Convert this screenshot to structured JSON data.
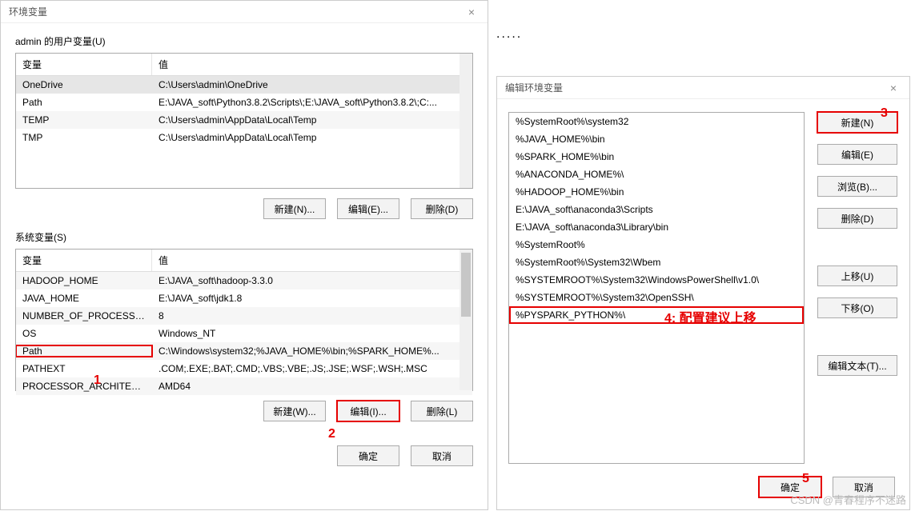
{
  "ellipsis": ".....",
  "dlg1": {
    "title": "环境变量",
    "user_section": "admin 的用户变量(U)",
    "sys_section": "系统变量(S)",
    "cols": {
      "var": "变量",
      "val": "值"
    },
    "user_vars": [
      {
        "name": "OneDrive",
        "value": "C:\\Users\\admin\\OneDrive"
      },
      {
        "name": "Path",
        "value": "E:\\JAVA_soft\\Python3.8.2\\Scripts\\;E:\\JAVA_soft\\Python3.8.2\\;C:..."
      },
      {
        "name": "TEMP",
        "value": "C:\\Users\\admin\\AppData\\Local\\Temp"
      },
      {
        "name": "TMP",
        "value": "C:\\Users\\admin\\AppData\\Local\\Temp"
      }
    ],
    "sys_vars": [
      {
        "name": "HADOOP_HOME",
        "value": "E:\\JAVA_soft\\hadoop-3.3.0"
      },
      {
        "name": "JAVA_HOME",
        "value": "E:\\JAVA_soft\\jdk1.8"
      },
      {
        "name": "NUMBER_OF_PROCESSORS",
        "value": "8"
      },
      {
        "name": "OS",
        "value": "Windows_NT"
      },
      {
        "name": "Path",
        "value": "C:\\Windows\\system32;%JAVA_HOME%\\bin;%SPARK_HOME%..."
      },
      {
        "name": "PATHEXT",
        "value": ".COM;.EXE;.BAT;.CMD;.VBS;.VBE;.JS;.JSE;.WSF;.WSH;.MSC"
      },
      {
        "name": "PROCESSOR_ARCHITECT...",
        "value": "AMD64"
      }
    ],
    "buttons": {
      "user_new": "新建(N)...",
      "user_edit": "编辑(E)...",
      "user_del": "删除(D)",
      "sys_new": "新建(W)...",
      "sys_edit": "编辑(I)...",
      "sys_del": "删除(L)",
      "ok": "确定",
      "cancel": "取消"
    }
  },
  "dlg2": {
    "title": "编辑环境变量",
    "paths": [
      "%SystemRoot%\\system32",
      "%JAVA_HOME%\\bin",
      "%SPARK_HOME%\\bin",
      "%ANACONDA_HOME%\\",
      "%HADOOP_HOME%\\bin",
      "E:\\JAVA_soft\\anaconda3\\Scripts",
      "E:\\JAVA_soft\\anaconda3\\Library\\bin",
      "%SystemRoot%",
      "%SystemRoot%\\System32\\Wbem",
      "%SYSTEMROOT%\\System32\\WindowsPowerShell\\v1.0\\",
      "%SYSTEMROOT%\\System32\\OpenSSH\\",
      "%PYSPARK_PYTHON%\\"
    ],
    "buttons": {
      "new": "新建(N)",
      "edit": "编辑(E)",
      "browse": "浏览(B)...",
      "delete": "删除(D)",
      "up": "上移(U)",
      "down": "下移(O)",
      "edit_text": "编辑文本(T)...",
      "ok": "确定",
      "cancel": "取消"
    }
  },
  "annotations": {
    "a1": "1",
    "a2": "2",
    "a3": "3",
    "a4": "4: 配置建议上移",
    "a5": "5"
  },
  "watermark": "CSDN @青春程序不迷路"
}
